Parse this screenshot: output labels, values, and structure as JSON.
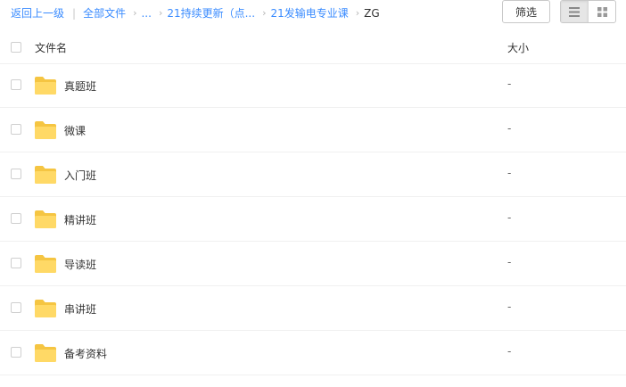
{
  "breadcrumb": {
    "back_label": "返回上一级",
    "all_files_label": "全部文件",
    "separator": "|",
    "chevron": "›",
    "items": [
      "...",
      "21持续更新（点...",
      "21发输电专业课"
    ],
    "current": "ZG"
  },
  "toolbar": {
    "filter_label": "筛选",
    "view_mode": "list"
  },
  "table": {
    "header_name": "文件名",
    "header_size": "大小",
    "rows": [
      {
        "name": "真题班",
        "size": "-"
      },
      {
        "name": "微课",
        "size": "-"
      },
      {
        "name": "入门班",
        "size": "-"
      },
      {
        "name": "精讲班",
        "size": "-"
      },
      {
        "name": "导读班",
        "size": "-"
      },
      {
        "name": "串讲班",
        "size": "-"
      },
      {
        "name": "备考资料",
        "size": "-"
      }
    ]
  },
  "colors": {
    "link": "#3b8cff",
    "folder_back": "#f5c542",
    "folder_front": "#ffd966"
  },
  "icons": {
    "folder": "folder-icon",
    "list_view": "list-view-icon",
    "grid_view": "grid-view-icon"
  }
}
